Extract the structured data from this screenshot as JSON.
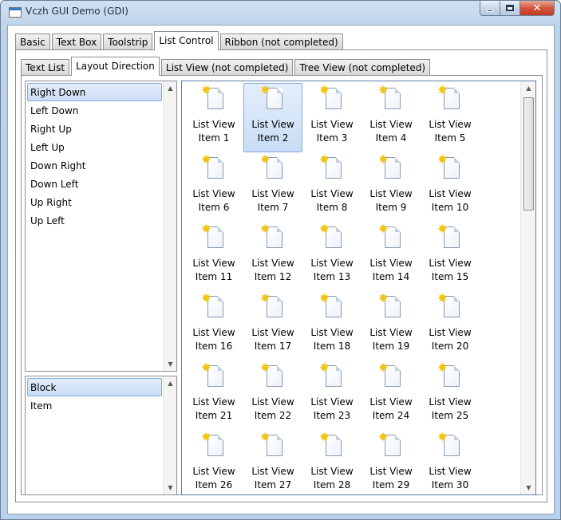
{
  "window": {
    "title": "Vczh GUI Demo (GDI)",
    "caption_buttons": {
      "minimize": "minimize",
      "maximize": "maximize",
      "close": "✕"
    }
  },
  "outer_tabs": [
    {
      "label": "Basic",
      "active": false
    },
    {
      "label": "Text Box",
      "active": false
    },
    {
      "label": "Toolstrip",
      "active": false
    },
    {
      "label": "List Control",
      "active": true
    },
    {
      "label": "Ribbon (not completed)",
      "active": false
    }
  ],
  "inner_tabs": [
    {
      "label": "Text List",
      "active": false
    },
    {
      "label": "Layout Direction",
      "active": true
    },
    {
      "label": "List View (not completed)",
      "active": false
    },
    {
      "label": "Tree View (not completed)",
      "active": false
    }
  ],
  "direction_list": {
    "items": [
      "Right Down",
      "Left Down",
      "Right Up",
      "Left Up",
      "Down Right",
      "Down Left",
      "Up Right",
      "Up Left"
    ],
    "selected": "Right Down"
  },
  "mode_list": {
    "items": [
      "Block",
      "Item"
    ],
    "selected": "Block"
  },
  "list_view": {
    "icon": "new-document-icon",
    "selected_index": 1,
    "items": [
      [
        "List View",
        "Item 1"
      ],
      [
        "List View",
        "Item 2"
      ],
      [
        "List View",
        "Item 3"
      ],
      [
        "List View",
        "Item 4"
      ],
      [
        "List View",
        "Item 5"
      ],
      [
        "List View",
        "Item 6"
      ],
      [
        "List View",
        "Item 7"
      ],
      [
        "List View",
        "Item 8"
      ],
      [
        "List View",
        "Item 9"
      ],
      [
        "List View",
        "Item 10"
      ],
      [
        "List View",
        "Item 11"
      ],
      [
        "List View",
        "Item 12"
      ],
      [
        "List View",
        "Item 13"
      ],
      [
        "List View",
        "Item 14"
      ],
      [
        "List View",
        "Item 15"
      ],
      [
        "List View",
        "Item 16"
      ],
      [
        "List View",
        "Item 17"
      ],
      [
        "List View",
        "Item 18"
      ],
      [
        "List View",
        "Item 19"
      ],
      [
        "List View",
        "Item 20"
      ],
      [
        "List View",
        "Item 21"
      ],
      [
        "List View",
        "Item 22"
      ],
      [
        "List View",
        "Item 23"
      ],
      [
        "List View",
        "Item 24"
      ],
      [
        "List View",
        "Item 25"
      ],
      [
        "List View",
        "Item 26"
      ],
      [
        "List View",
        "Item 27"
      ],
      [
        "List View",
        "Item 28"
      ],
      [
        "List View",
        "Item 29"
      ],
      [
        "List View",
        "Item 30"
      ]
    ]
  }
}
